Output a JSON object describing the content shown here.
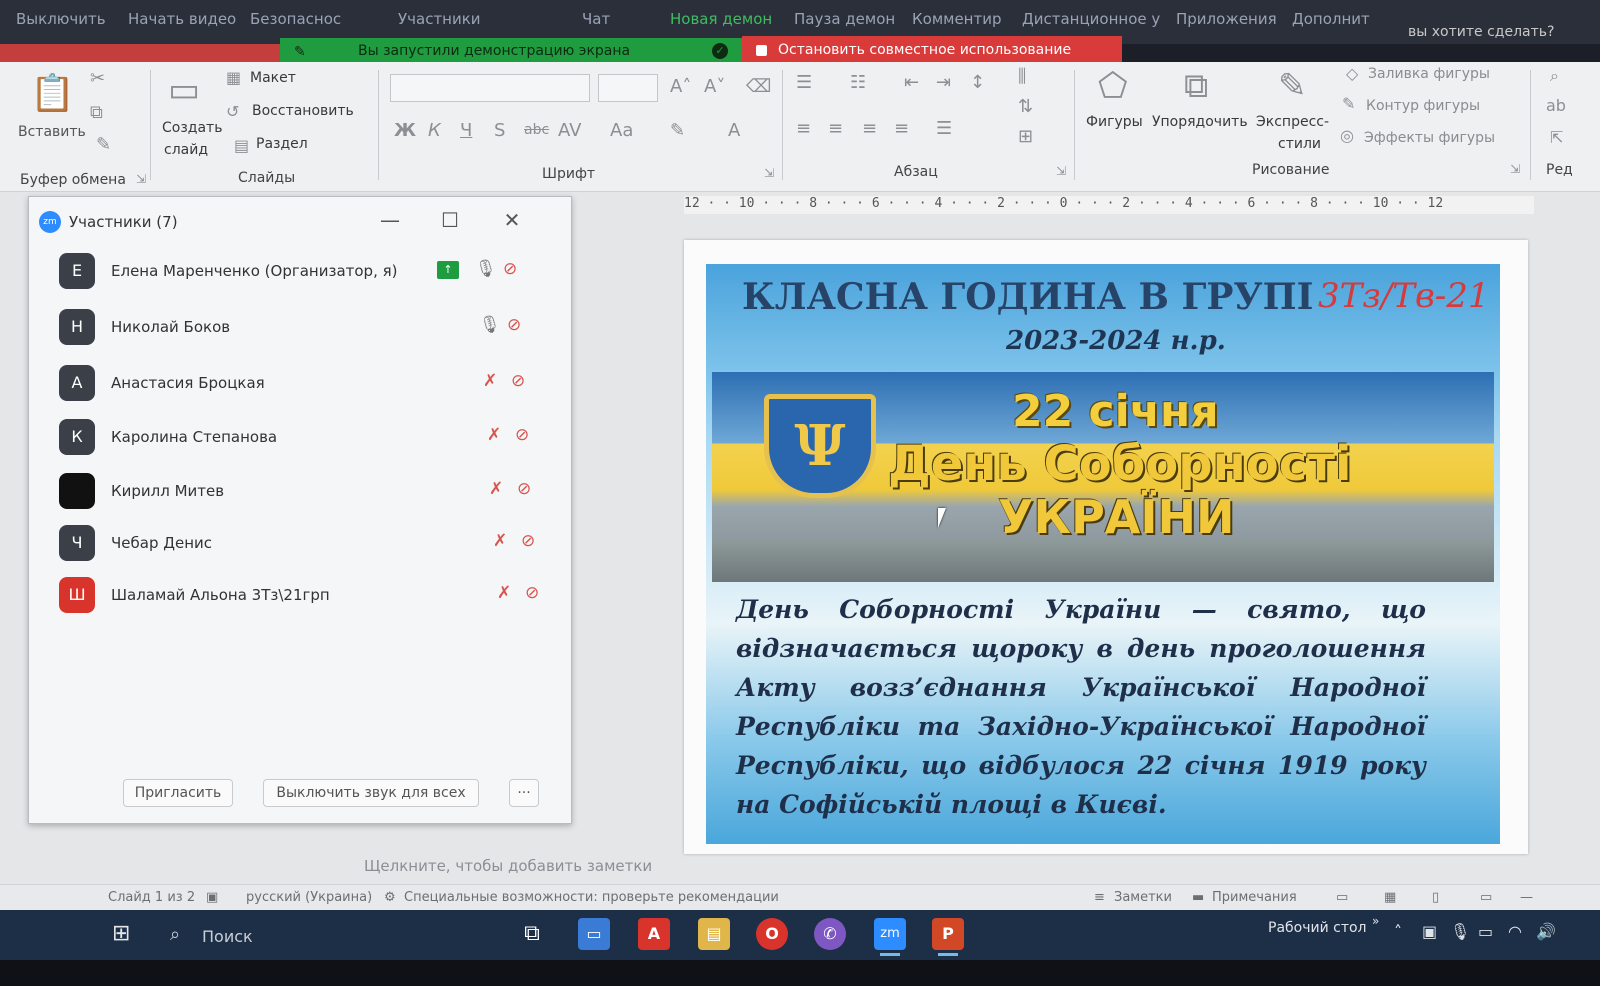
{
  "zoom_toolbar": {
    "items": [
      {
        "label": "Выключить"
      },
      {
        "label": "Начать видео"
      },
      {
        "label": "Безопаснос"
      },
      {
        "label": "Участники"
      },
      {
        "label": "Чат"
      },
      {
        "label": "Новая демон",
        "active": true
      },
      {
        "label": "Пауза демон"
      },
      {
        "label": "Комментир"
      },
      {
        "label": "Дистанционное у"
      },
      {
        "label": "Приложения"
      },
      {
        "label": "Дополнит"
      }
    ],
    "ask_text": "вы хотите сделать?"
  },
  "share_status": {
    "banner_text": "Вы запустили демонстрацию экрана",
    "stop_label": "Остановить совместное использование",
    "banner_color": "#1f9c3f",
    "stop_color": "#d93b3b"
  },
  "ribbon": {
    "clipboard": {
      "paste_label": "Вставить",
      "group_label": "Буфер обмена"
    },
    "slides": {
      "create_label": "Создать",
      "create_label_2": "слайд",
      "layout_label": "Макет",
      "restore_label": "Восстановить",
      "section_label": "Раздел",
      "group_label": "Слайды"
    },
    "font": {
      "group_label": "Шрифт",
      "bold": "Ж",
      "italic": "К",
      "underline": "Ч",
      "shadow": "S",
      "strike": "abc",
      "spacing": "AV",
      "case": "Aa",
      "color": "A",
      "grow": "A˄",
      "shrink": "A˅"
    },
    "paragraph": {
      "group_label": "Абзац"
    },
    "drawing": {
      "shapes_label": "Фигуры",
      "arrange_label": "Упорядочить",
      "quick_styles_label": "Экспресс-",
      "quick_styles_label_2": "стили",
      "fill_label": "Заливка фигуры",
      "outline_label": "Контур фигуры",
      "effects_label": "Эффекты фигуры",
      "group_label": "Рисование"
    },
    "edit_cut": "Ред"
  },
  "ruler": {
    "text": "12 · · 10 · · · 8 · · · 6 · · · 4 · · · 2 · · · 0 · · · 2 · · · 4 · · · 6 · · · 8 · · · 10 · · 12"
  },
  "slide": {
    "title": "КЛАСНА ГОДИНА В ГРУПІ",
    "group_code": "3Тз/Тв-21",
    "year": "2023-2024 н.р.",
    "banner_date": "22 січня",
    "banner_name": "День Соборності",
    "banner_country": "УКРАЇНИ",
    "coat_symbol": "Ψ",
    "body": "День Соборності України — свято, що відзначається щороку в день проголошення Акту возз’єднання Української Народної Республіки та Західно-Української Народної Республіки, що відбулося 22 січня 1919 року на Софійській площі в Києві."
  },
  "participants": {
    "title": "Участники (7)",
    "logo": "zm",
    "list": [
      {
        "name": "Елена Маренченко (Организатор, я)",
        "avatar": "Е",
        "mic_muted": false,
        "sharing": true
      },
      {
        "name": "Николай Боков",
        "avatar": "Н",
        "mic_muted": false,
        "sharing": false
      },
      {
        "name": "Анастасия Броцкая",
        "avatar": "А",
        "mic_muted": true,
        "sharing": false
      },
      {
        "name": "Каролина Степанова",
        "avatar": "К",
        "mic_muted": true,
        "sharing": false
      },
      {
        "name": "Кирилл Митев",
        "avatar": "",
        "mic_muted": true,
        "sharing": false
      },
      {
        "name": "Чебар Денис",
        "avatar": "Ч",
        "mic_muted": true,
        "sharing": false
      },
      {
        "name": "Шаламай Альона 3Тз\\21грп",
        "avatar": "Ш",
        "avatar_color": "#d9342b",
        "mic_muted": true,
        "sharing": false
      }
    ],
    "invite_label": "Пригласить",
    "mute_all_label": "Выключить звук для всех",
    "more_label": "···"
  },
  "notes_placeholder": "Щелкните, чтобы добавить заметки",
  "statusbar": {
    "slide_info": "Слайд 1 из 2",
    "language": "русский (Украина)",
    "accessibility": "Специальные возможности: проверьте рекомендации",
    "notes_label": "Заметки",
    "comments_label": "Примечания"
  },
  "taskbar": {
    "search_placeholder": "Поиск",
    "desktop_label": "Рабочий стол",
    "apps": [
      {
        "name": "task-view",
        "glyph": "⧉",
        "color": "#1d2f47"
      },
      {
        "name": "explorer-desktop",
        "glyph": "▭",
        "color": "#3a7bd5"
      },
      {
        "name": "acrobat",
        "glyph": "A",
        "color": "#d9342b"
      },
      {
        "name": "file-explorer",
        "glyph": "▤",
        "color": "#e0b64a"
      },
      {
        "name": "opera",
        "glyph": "O",
        "color": "#d9342b"
      },
      {
        "name": "viber",
        "glyph": "✆",
        "color": "#7e57c2"
      },
      {
        "name": "zoom",
        "glyph": "zm",
        "color": "#2d8cff",
        "open": true
      },
      {
        "name": "powerpoint",
        "glyph": "P",
        "color": "#d24726",
        "open": true
      }
    ]
  }
}
